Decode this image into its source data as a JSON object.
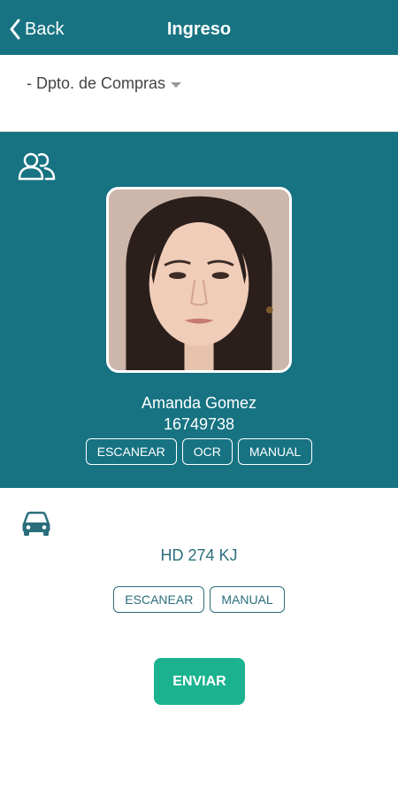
{
  "header": {
    "back_label": "Back",
    "title": "Ingreso",
    "color": "#177382"
  },
  "department": {
    "selected": "- Dpto. de Compras"
  },
  "person": {
    "section_icon": "people-icon",
    "name": "Amanda Gomez",
    "id_number": "16749738",
    "buttons": {
      "scan": "ESCANEAR",
      "ocr": "OCR",
      "manual": "MANUAL"
    }
  },
  "vehicle": {
    "section_icon": "car-icon",
    "plate": "HD 274 KJ",
    "buttons": {
      "scan": "ESCANEAR",
      "manual": "MANUAL"
    }
  },
  "submit": {
    "label": "ENVIAR",
    "color": "#1bb38f"
  }
}
